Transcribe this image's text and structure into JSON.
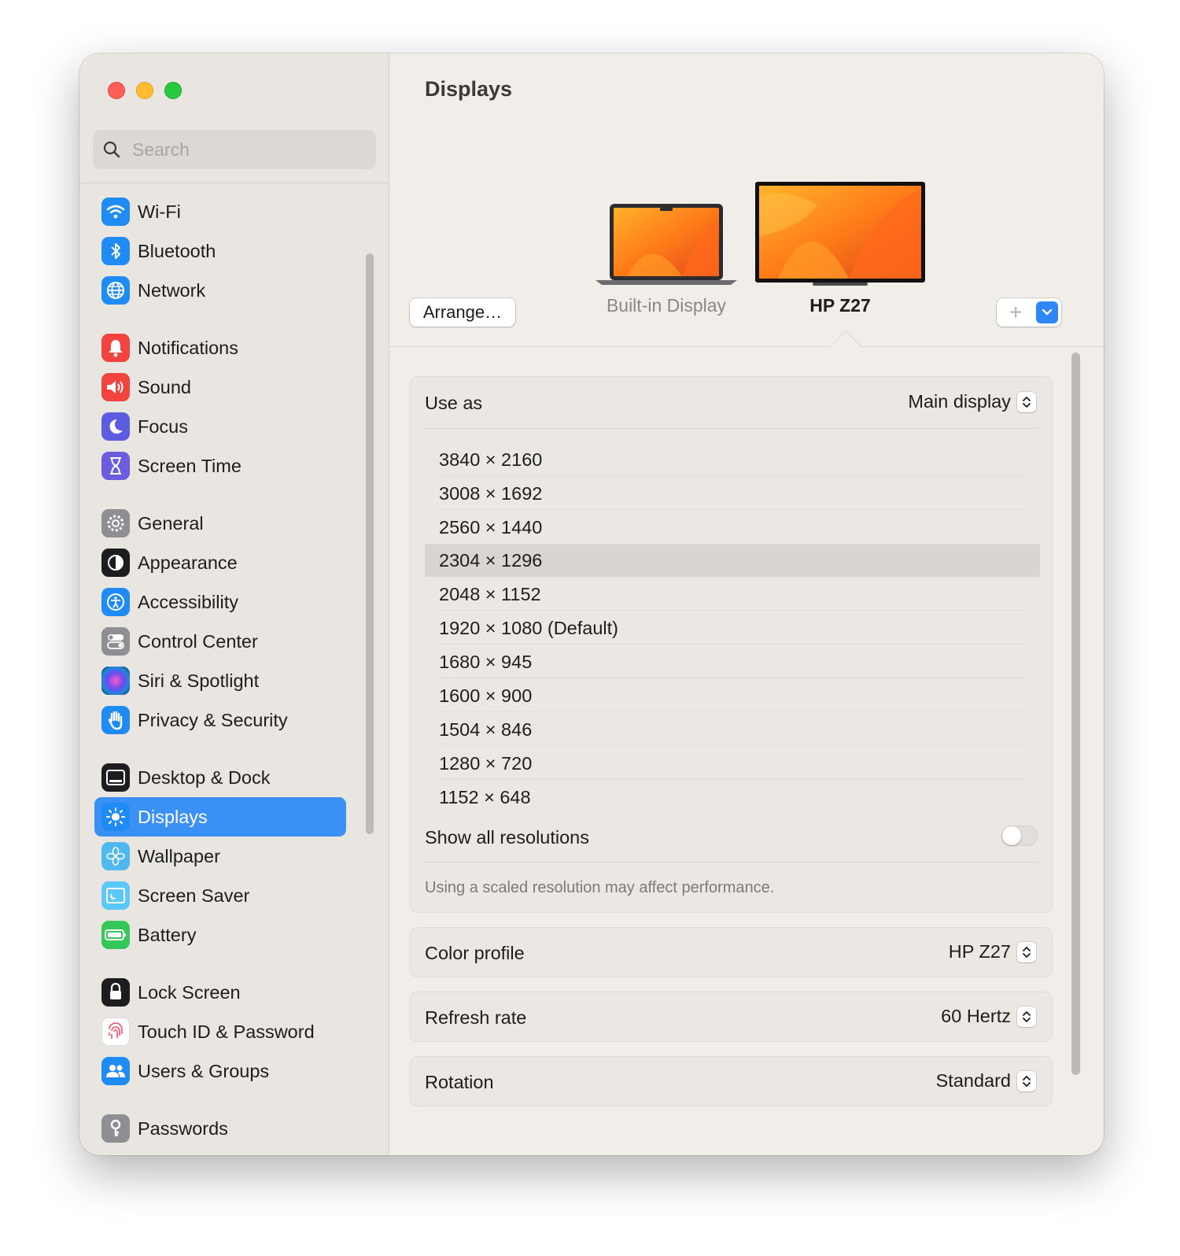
{
  "window": {
    "traffic_lights": [
      "close",
      "minimize",
      "zoom"
    ]
  },
  "sidebar": {
    "search": {
      "placeholder": "Search",
      "value": ""
    },
    "items": [
      {
        "label": "Wi-Fi",
        "icon": "wifi-icon",
        "color": "#1f8cf6"
      },
      {
        "label": "Bluetooth",
        "icon": "bluetooth-icon",
        "color": "#1f8cf6"
      },
      {
        "label": "Network",
        "icon": "globe-icon",
        "color": "#1f8cf6"
      },
      {
        "label": "Notifications",
        "icon": "bell-icon",
        "color": "#f2433f"
      },
      {
        "label": "Sound",
        "icon": "speaker-icon",
        "color": "#f2433f"
      },
      {
        "label": "Focus",
        "icon": "moon-icon",
        "color": "#5c5ce0"
      },
      {
        "label": "Screen Time",
        "icon": "hourglass-icon",
        "color": "#6e5ce0"
      },
      {
        "label": "General",
        "icon": "gear-icon",
        "color": "#8e8e93"
      },
      {
        "label": "Appearance",
        "icon": "appearance-icon",
        "color": "#1d1d1f"
      },
      {
        "label": "Accessibility",
        "icon": "accessibility-icon",
        "color": "#1f8cf6"
      },
      {
        "label": "Control Center",
        "icon": "control-center-icon",
        "color": "#8e8e93"
      },
      {
        "label": "Siri & Spotlight",
        "icon": "siri-icon",
        "color": "#2b2b55"
      },
      {
        "label": "Privacy & Security",
        "icon": "hand-icon",
        "color": "#1f8cf6"
      },
      {
        "label": "Desktop & Dock",
        "icon": "dock-icon",
        "color": "#1d1d1f"
      },
      {
        "label": "Displays",
        "icon": "sun-icon",
        "color": "#1f8cf6",
        "selected": true
      },
      {
        "label": "Wallpaper",
        "icon": "flower-icon",
        "color": "#4fb8f0"
      },
      {
        "label": "Screen Saver",
        "icon": "screen-saver-icon",
        "color": "#5ac8fa"
      },
      {
        "label": "Battery",
        "icon": "battery-icon",
        "color": "#34c759"
      },
      {
        "label": "Lock Screen",
        "icon": "lock-icon",
        "color": "#1d1d1f"
      },
      {
        "label": "Touch ID & Password",
        "icon": "fingerprint-icon",
        "color": "#ffffff"
      },
      {
        "label": "Users & Groups",
        "icon": "users-icon",
        "color": "#1f8cf6"
      },
      {
        "label": "Passwords",
        "icon": "key-icon",
        "color": "#8e8e93"
      }
    ]
  },
  "main": {
    "title": "Displays",
    "arrange_label": "Arrange…",
    "displays": [
      {
        "name": "Built-in Display",
        "selected": false
      },
      {
        "name": "HP Z27",
        "selected": true
      }
    ],
    "add_button": {
      "plus": "+",
      "icon": "chevron-down-icon"
    },
    "use_as": {
      "label": "Use as",
      "value": "Main display"
    },
    "resolutions": [
      "3840 × 2160",
      "3008 × 1692",
      "2560 × 1440",
      "2304 × 1296",
      "2048 × 1152",
      "1920 × 1080 (Default)",
      "1680 × 945",
      "1600 × 900",
      "1504 × 846",
      "1280 × 720",
      "1152 × 648"
    ],
    "selected_resolution": "2304 × 1296",
    "show_all": {
      "label": "Show all resolutions",
      "enabled": false
    },
    "note": "Using a scaled resolution may affect performance.",
    "color_profile": {
      "label": "Color profile",
      "value": "HP Z27"
    },
    "refresh_rate": {
      "label": "Refresh rate",
      "value": "60 Hertz"
    },
    "rotation": {
      "label": "Rotation",
      "value": "Standard"
    }
  }
}
